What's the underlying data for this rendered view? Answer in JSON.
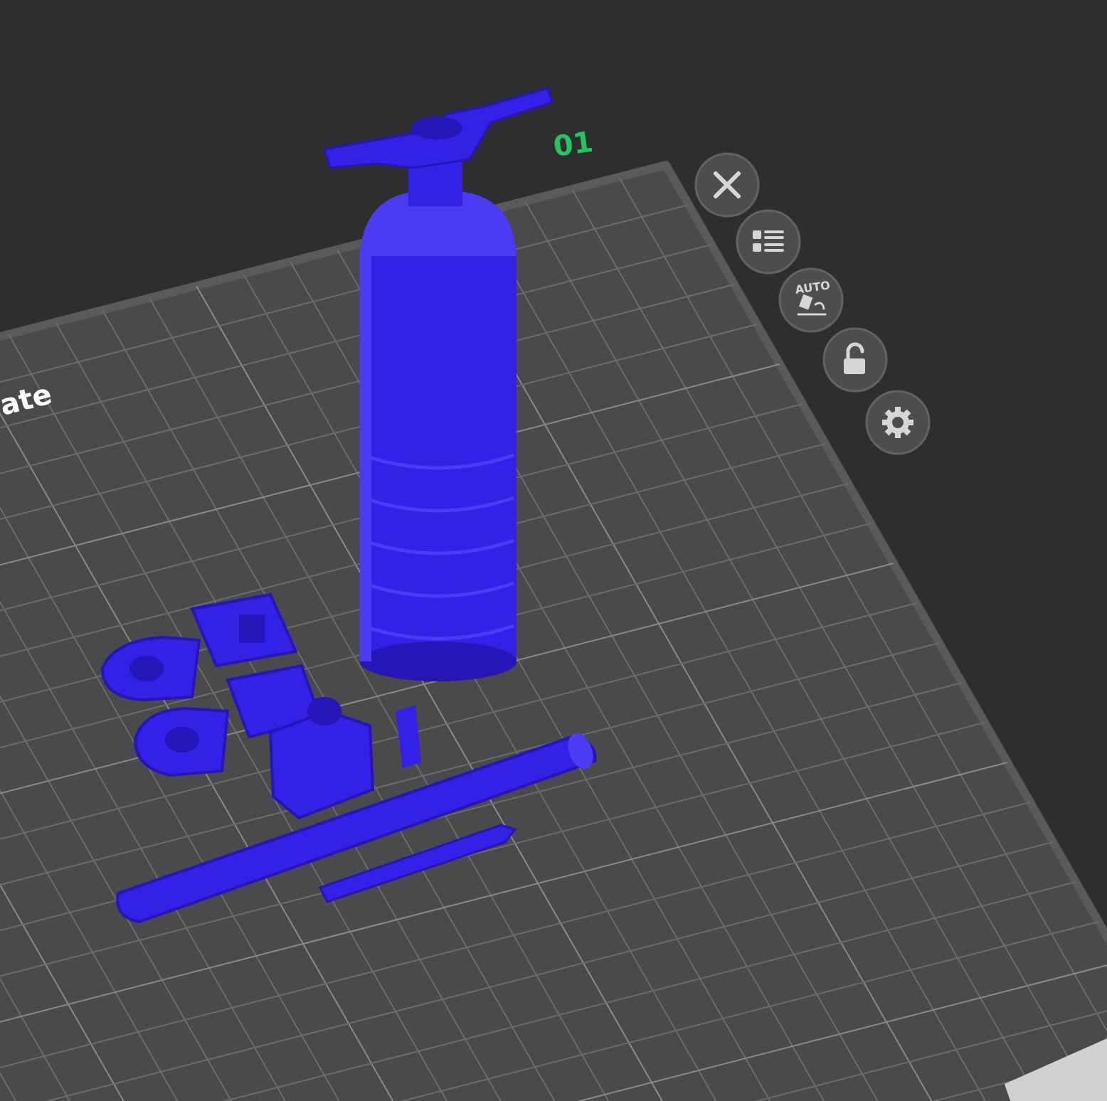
{
  "plate": {
    "number": "01",
    "name": "ate"
  },
  "toolbar": [
    {
      "kind": "close"
    },
    {
      "kind": "list"
    },
    {
      "kind": "arrange",
      "label": "AUTO"
    },
    {
      "kind": "lock"
    },
    {
      "kind": "settings"
    }
  ]
}
